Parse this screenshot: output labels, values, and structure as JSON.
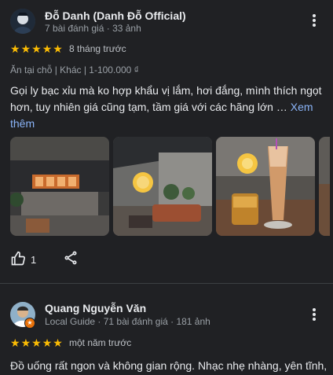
{
  "reviews": [
    {
      "name": "Đỗ Danh (Danh Đỗ Official)",
      "meta": "7 bài đánh giá · 33 ảnh",
      "rating": 5,
      "date": "8 tháng trước",
      "tags": "Ăn tại chỗ  |  Khác  |  1-100.000 ₫",
      "text": "Gọi ly bạc xỉu mà ko hợp khẩu vị lắm, hơi đắng, mình thích ngọt hơn, tuy nhiên giá cũng tạm, tầm giá với các hãng lớn … ",
      "more_link": "Xem thêm",
      "likes": "1"
    },
    {
      "name": "Quang Nguyễn Văn",
      "meta": "Local Guide · 71 bài đánh giá · 181 ảnh",
      "rating": 5,
      "date": "một năm trước",
      "text": "Đồ uống rất ngon và không gian rộng. Nhạc nhẹ nhàng, yên tĩnh,"
    }
  ],
  "icons": {
    "star": "star-icon",
    "more": "more-vert-icon",
    "like": "thumb-up-icon",
    "share": "share-icon",
    "local_guide": "local-guide-badge-icon"
  },
  "colors": {
    "background": "#202124",
    "star": "#fbbc04",
    "link": "#8ab4f8",
    "secondary_text": "#9aa0a6"
  }
}
